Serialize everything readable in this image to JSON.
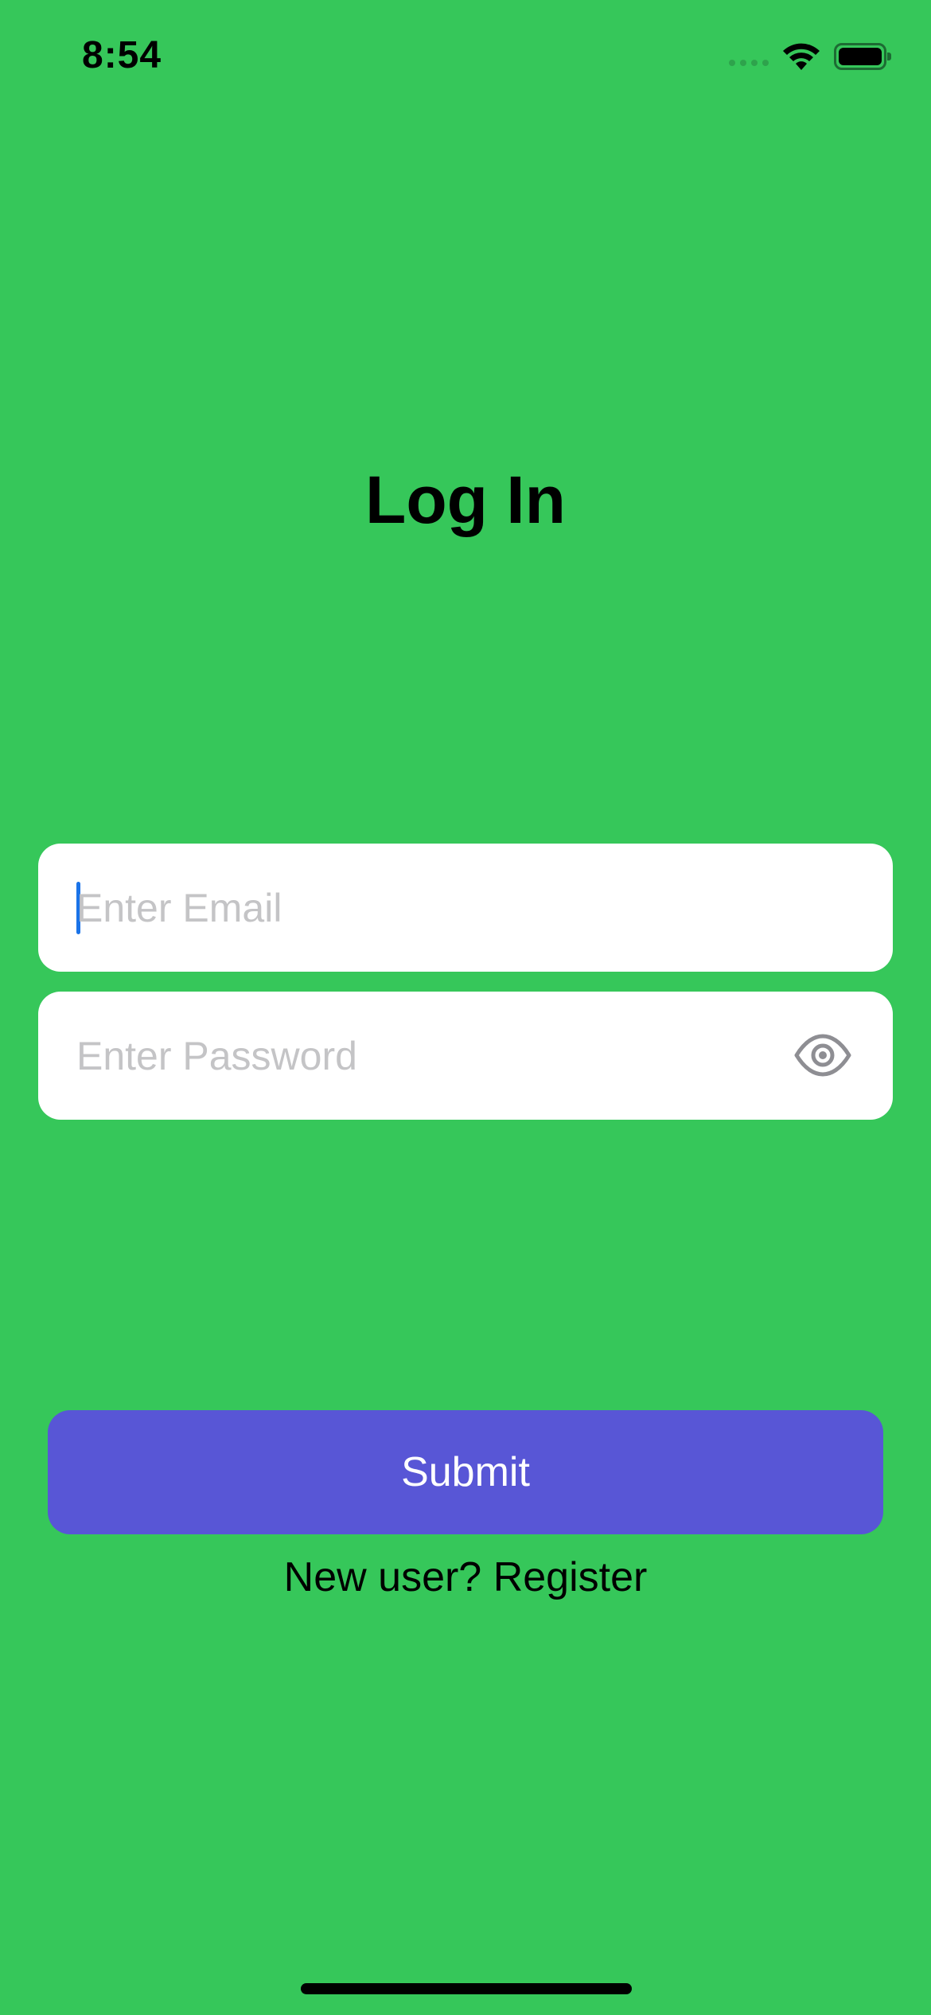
{
  "status_bar": {
    "time": "8:54",
    "icons": [
      "signal-icon",
      "wifi-icon",
      "battery-icon"
    ]
  },
  "login": {
    "title": "Log In",
    "email_placeholder": "Enter Email",
    "email_value": "",
    "password_placeholder": "Enter Password",
    "password_value": "",
    "show_password_icon": "eye-icon",
    "submit_label": "Submit",
    "register_prompt": "New user?",
    "register_link": "Register"
  },
  "colors": {
    "background": "#36c75a",
    "button": "#5856d6",
    "caret": "#1a73e8",
    "placeholder": "#c4c4c6"
  }
}
